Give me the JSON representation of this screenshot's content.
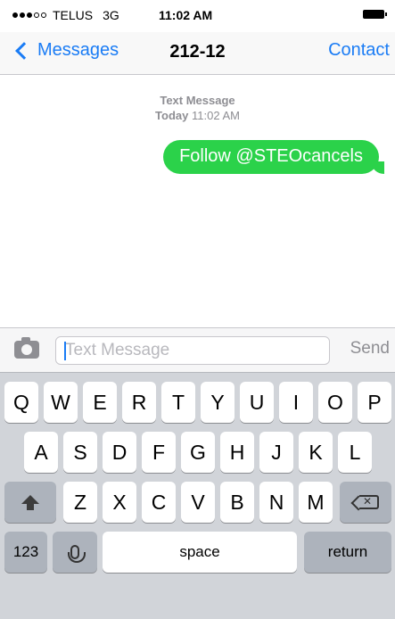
{
  "status_bar": {
    "carrier": "TELUS",
    "network": "3G",
    "time": "11:02 AM",
    "signal_bars_filled": 3,
    "signal_bars_total": 5
  },
  "nav": {
    "back_label": "Messages",
    "title": "212-12",
    "contact_label": "Contact"
  },
  "conversation": {
    "service_label": "Text Message",
    "day": "Today",
    "time": "11:02 AM",
    "messages": [
      {
        "text": "Follow @STEOcancels",
        "direction": "outgoing",
        "color": "#2bd24a"
      }
    ]
  },
  "composer": {
    "placeholder": "Text Message",
    "value": "",
    "send_label": "Send"
  },
  "keyboard": {
    "row1": [
      "Q",
      "W",
      "E",
      "R",
      "T",
      "Y",
      "U",
      "I",
      "O",
      "P"
    ],
    "row2": [
      "A",
      "S",
      "D",
      "F",
      "G",
      "H",
      "J",
      "K",
      "L"
    ],
    "row3": [
      "Z",
      "X",
      "C",
      "V",
      "B",
      "N",
      "M"
    ],
    "numbers_label": "123",
    "space_label": "space",
    "return_label": "return"
  },
  "colors": {
    "accent": "#1a7cf5",
    "bubble": "#2bd24a",
    "keyboard_bg": "#d1d4d9"
  }
}
